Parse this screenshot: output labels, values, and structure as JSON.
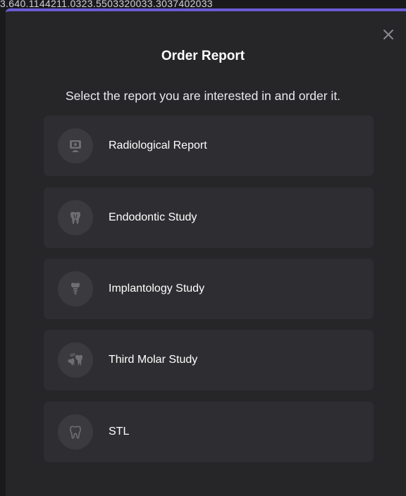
{
  "background": {
    "strip_text": "3.640.1144211.0323.5503320033.3037402033"
  },
  "modal": {
    "title": "Order Report",
    "subtitle": "Select the report you are interested in and order it.",
    "close_icon": "close-icon",
    "accent_color": "#6b5bd6"
  },
  "options": [
    {
      "label": "Radiological Report",
      "icon": "radiological-report-icon"
    },
    {
      "label": "Endodontic Study",
      "icon": "tooth-root-icon"
    },
    {
      "label": "Implantology Study",
      "icon": "dental-implant-icon"
    },
    {
      "label": "Third Molar Study",
      "icon": "third-molar-icon"
    },
    {
      "label": "STL",
      "icon": "tooth-outline-icon"
    }
  ]
}
